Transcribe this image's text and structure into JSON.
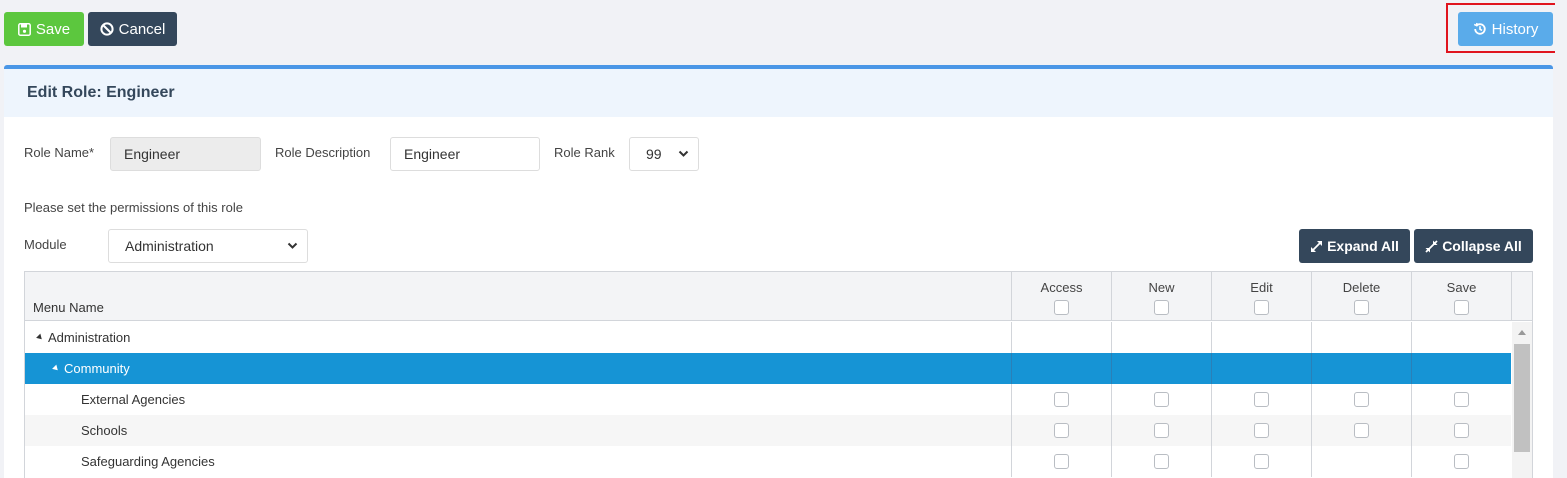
{
  "toolbar": {
    "save_label": "Save",
    "cancel_label": "Cancel",
    "history_label": "History"
  },
  "card": {
    "title": "Edit Role: Engineer"
  },
  "form": {
    "role_name_label": "Role Name*",
    "role_name_value": "Engineer",
    "role_desc_label": "Role Description",
    "role_desc_value": "Engineer",
    "role_rank_label": "Role Rank",
    "role_rank_value": "99",
    "permissions_note": "Please set the permissions of this role",
    "module_label": "Module",
    "module_value": "Administration"
  },
  "tree_buttons": {
    "expand_label": "Expand All",
    "collapse_label": "Collapse All"
  },
  "grid": {
    "menu_header": "Menu Name",
    "columns": [
      "Access",
      "New",
      "Edit",
      "Delete",
      "Save"
    ],
    "rows": [
      {
        "label": "Administration",
        "level": 0,
        "expanded": true,
        "selected": false,
        "checkboxes": [
          false,
          false,
          false,
          false,
          false
        ]
      },
      {
        "label": "Community",
        "level": 1,
        "expanded": true,
        "selected": true,
        "checkboxes": [
          false,
          false,
          false,
          false,
          false
        ]
      },
      {
        "label": "External Agencies",
        "level": 2,
        "expanded": false,
        "selected": false,
        "checkboxes": [
          true,
          true,
          true,
          true,
          true
        ]
      },
      {
        "label": "Schools",
        "level": 2,
        "expanded": false,
        "selected": false,
        "checkboxes": [
          true,
          true,
          true,
          true,
          true
        ]
      },
      {
        "label": "Safeguarding Agencies",
        "level": 2,
        "expanded": false,
        "selected": false,
        "checkboxes": [
          true,
          true,
          true,
          false,
          true
        ]
      }
    ]
  },
  "colors": {
    "save_green": "#5cc73e",
    "dark_slate": "#34475b",
    "history_blue": "#5aabea",
    "selected_row": "#1694d5",
    "highlight_red": "#e0141e"
  }
}
